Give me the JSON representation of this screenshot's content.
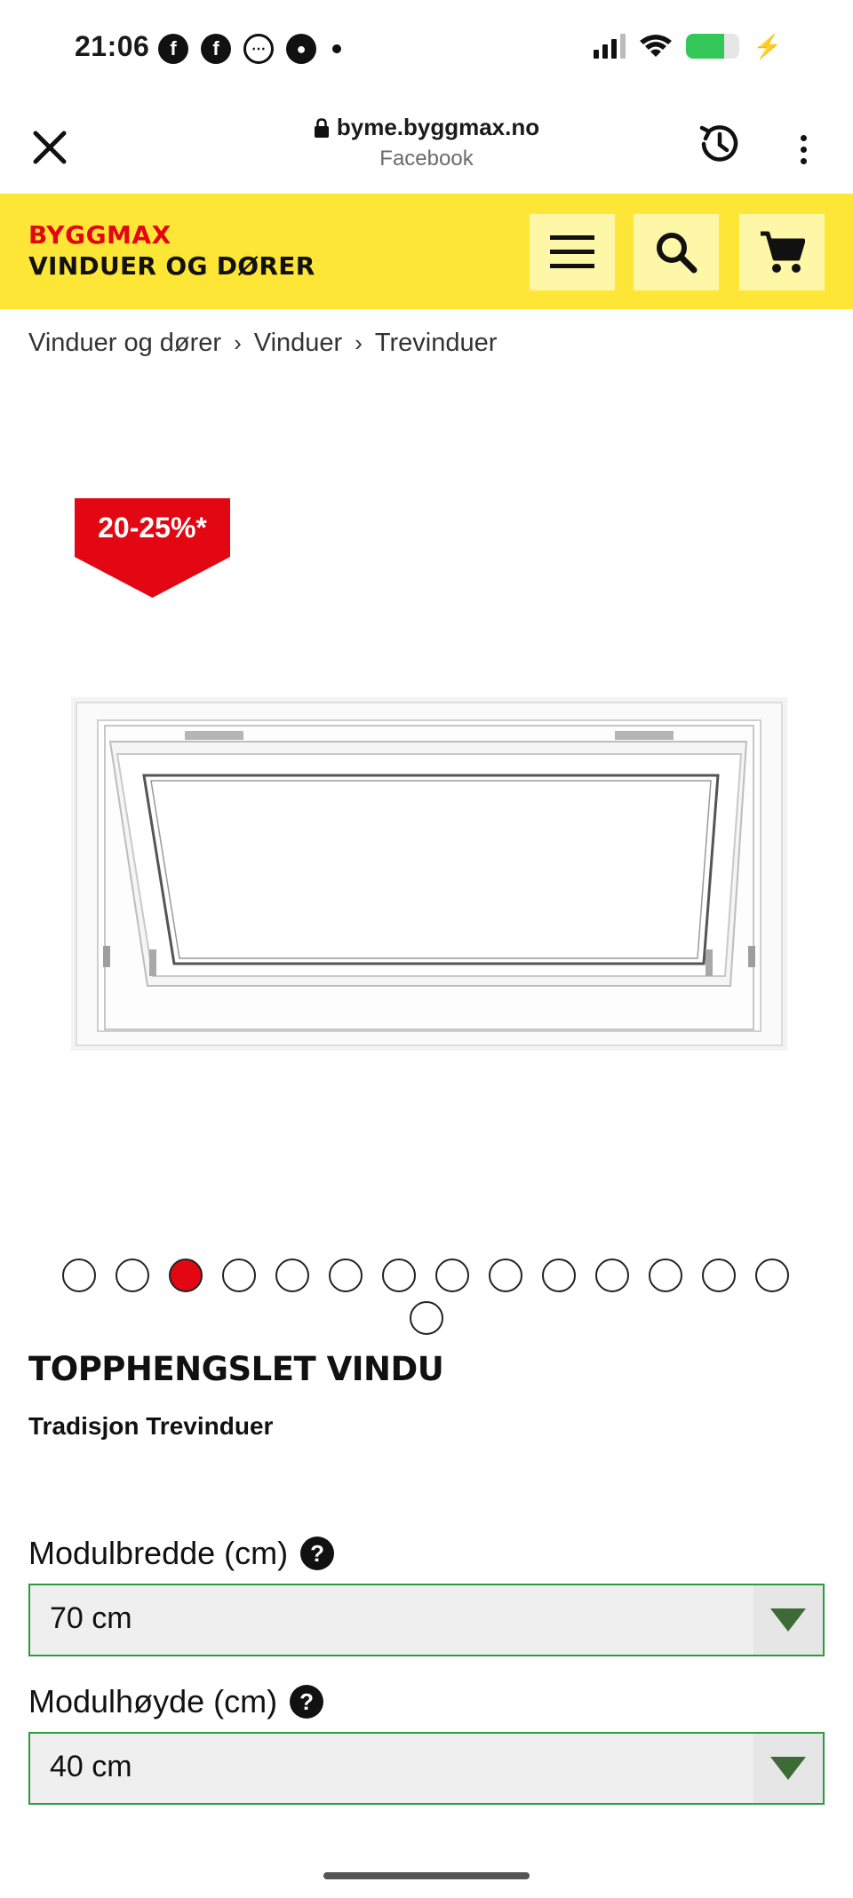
{
  "status_bar": {
    "time": "21:06",
    "left_icons": [
      "facebook-icon",
      "facebook-icon",
      "messenger-icon",
      "chat-icon"
    ],
    "battery_level": 0.72,
    "battery_color": "#34c759"
  },
  "browser": {
    "url": "byme.byggmax.no",
    "source": "Facebook"
  },
  "header": {
    "brand_top": "BYGGMAX",
    "brand_bottom": "VINDUER OG DØRER",
    "background_color": "#fde635",
    "brand_color": "#e30613"
  },
  "breadcrumb": [
    "Vinduer og dører",
    "Vinduer",
    "Trevinduer"
  ],
  "product": {
    "badge": "20-25%*",
    "badge_color": "#e30613",
    "title": "TOPPHENGSLET VINDU",
    "subtitle": "Tradisjon Trevinduer"
  },
  "carousel": {
    "total": 15,
    "active_index": 2
  },
  "options": [
    {
      "label": "Modulbredde (cm)",
      "value": "70 cm"
    },
    {
      "label": "Modulhøyde (cm)",
      "value": "40 cm"
    }
  ],
  "accent_color": "#2e9b3e"
}
